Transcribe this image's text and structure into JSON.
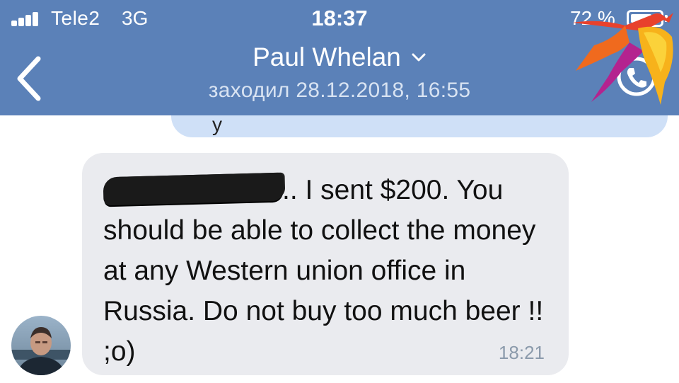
{
  "status_bar": {
    "carrier": "Tele2",
    "network": "3G",
    "time": "18:37",
    "battery_text": "72 %",
    "battery_level": 0.72
  },
  "header": {
    "contact_name": "Paul Whelan",
    "last_seen": "заходил 28.12.2018, 16:55",
    "background_color": "#5b81b8"
  },
  "message": {
    "text": ".. I sent $200. You should be able to collect the money at any Western union office in Russia. Do not buy too much beer !! ;o)",
    "time": "18:21",
    "bubble_color": "#eaebef"
  },
  "icons": {
    "back": "chevron-left-icon",
    "dropdown": "chevron-down-icon",
    "call": "phone-call-icon",
    "avatar": "contact-avatar"
  },
  "colors": {
    "outgoing_bubble": "#cfe0f7",
    "header_text": "#ffffff",
    "timestamp": "#8b9aab"
  }
}
